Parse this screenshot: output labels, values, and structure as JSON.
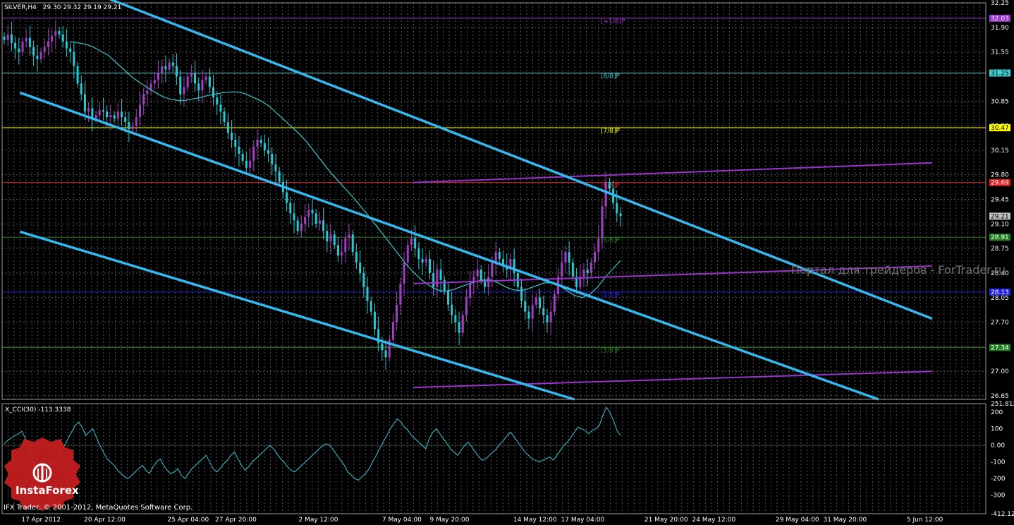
{
  "header": {
    "symbol": "SILVER,H4",
    "ohlc": "29.30 29.32 29.19 29.21"
  },
  "watermark": "Портал для трейдеров - ForTrader.ru",
  "copyright": "IFX Trader, © 2001-2012, MetaQuotes Software Corp.",
  "logo_text": "InstaForex",
  "colors": {
    "background": "#000000",
    "grid": "#5a5a5a",
    "channel": "#33b8f0",
    "ma": "#38c8c8",
    "pitchfork": "#9933cc",
    "bull_start": "#a040c0",
    "bear_start": "#28c8d0",
    "cci": "#38c8d8",
    "logo_red": "#c81e1e"
  },
  "chart_data": {
    "type": "candlestick",
    "symbol": "SILVER",
    "timeframe": "H4",
    "y_ticks": [
      "32.25",
      "31.90",
      "31.55",
      "31.25",
      "30.85",
      "30.50",
      "30.15",
      "29.80",
      "29.45",
      "29.10",
      "28.75",
      "28.40",
      "28.05",
      "27.70",
      "27.35",
      "27.00",
      "26.65"
    ],
    "ylim": [
      26.6,
      32.25
    ],
    "x_ticks": [
      "17 Apr 2012",
      "20 Apr 12:00",
      "25 Apr 04:00",
      "27 Apr 20:00",
      "2 May 12:00",
      "7 May 04:00",
      "9 May 20:00",
      "14 May 12:00",
      "17 May 04:00",
      "21 May 20:00",
      "24 May 12:00",
      "29 May 04:00",
      "31 May 20:00",
      "5 Jun 12:00"
    ],
    "price_tags": [
      {
        "label": "32.03",
        "color": "#9933cc",
        "text_color": "#ffffff"
      },
      {
        "label": "31.25",
        "color": "#40d0d0",
        "text_color": "#000000"
      },
      {
        "label": "30.47",
        "color": "#ffff00",
        "text_color": "#000000"
      },
      {
        "label": "29.69",
        "color": "#e02020",
        "text_color": "#ffffff"
      },
      {
        "label": "29.21",
        "color": "#c0c0c0",
        "text_color": "#000000"
      },
      {
        "label": "28.91",
        "color": "#208020",
        "text_color": "#ffffff"
      },
      {
        "label": "28.13",
        "color": "#2020e0",
        "text_color": "#ffffff"
      },
      {
        "label": "27.34",
        "color": "#208020",
        "text_color": "#ffffff"
      }
    ],
    "murrey_levels": [
      {
        "label": "[+1/8]P",
        "price": 32.03,
        "color": "#9933cc"
      },
      {
        "label": "[8/8]P",
        "price": 31.25,
        "color": "#40d0d0"
      },
      {
        "label": "[7/8]P",
        "price": 30.47,
        "color": "#ffff00"
      },
      {
        "label": "[6/8]P",
        "price": 29.69,
        "color": "#e02020"
      },
      {
        "label": "[5/8]P",
        "price": 28.91,
        "color": "#208020"
      },
      {
        "label": "[4/8]P",
        "price": 28.13,
        "color": "#2020e0"
      },
      {
        "label": "[3/8]P",
        "price": 27.34,
        "color": "#208020"
      }
    ],
    "channel_lines": [
      {
        "from_date": "17 Apr 2012",
        "from": 32.8,
        "to_date": "7 Jun 2012",
        "to": 27.75
      },
      {
        "from_date": "17 Apr 2012",
        "from": 30.97,
        "to_date": "4 Jun 2012",
        "to": 26.6
      },
      {
        "from_date": "17 Apr 2012",
        "from": 28.99,
        "to_date": "18 May 2012",
        "to": 26.6
      }
    ],
    "pitchfork_lines": [
      {
        "from_date": "9 May 2012",
        "from": 29.69,
        "to_date": "7 Jun 2012",
        "to": 29.97
      },
      {
        "from_date": "9 May 2012",
        "from": 28.25,
        "to_date": "7 Jun 2012",
        "to": 28.5
      },
      {
        "from_date": "9 May 2012",
        "from": 26.77,
        "to_date": "7 Jun 2012",
        "to": 27.0
      }
    ],
    "close": [
      31.72,
      31.8,
      31.68,
      31.6,
      31.55,
      31.7,
      31.75,
      31.62,
      31.5,
      31.45,
      31.55,
      31.62,
      31.7,
      31.78,
      31.85,
      31.8,
      31.7,
      31.6,
      31.55,
      31.35,
      31.1,
      30.95,
      30.7,
      30.75,
      30.6,
      30.65,
      30.72,
      30.7,
      30.62,
      30.65,
      30.6,
      30.7,
      30.62,
      30.55,
      30.45,
      30.5,
      30.62,
      30.8,
      30.95,
      31.0,
      31.1,
      31.15,
      31.25,
      31.35,
      31.3,
      31.4,
      31.35,
      31.2,
      30.95,
      31.05,
      31.2,
      31.25,
      31.1,
      31.0,
      31.15,
      31.2,
      31.05,
      30.9,
      30.8,
      30.7,
      30.55,
      30.4,
      30.3,
      30.2,
      30.1,
      30.0,
      29.9,
      30.0,
      30.2,
      30.3,
      30.25,
      30.15,
      30.1,
      29.95,
      29.85,
      29.7,
      29.55,
      29.4,
      29.25,
      29.15,
      29.0,
      29.1,
      29.2,
      29.3,
      29.25,
      29.1,
      29.15,
      29.0,
      28.85,
      28.95,
      28.8,
      28.65,
      28.7,
      28.9,
      28.95,
      28.7,
      28.55,
      28.4,
      28.2,
      28.0,
      27.85,
      27.6,
      27.4,
      27.3,
      27.2,
      27.45,
      27.7,
      27.95,
      28.25,
      28.55,
      28.8,
      28.9,
      28.75,
      28.6,
      28.55,
      28.6,
      28.4,
      28.2,
      28.45,
      28.3,
      28.15,
      27.95,
      27.8,
      27.7,
      27.55,
      27.8,
      28.05,
      28.25,
      28.35,
      28.45,
      28.3,
      28.2,
      28.35,
      28.55,
      28.7,
      28.6,
      28.5,
      28.45,
      28.6,
      28.4,
      28.2,
      28.0,
      27.85,
      27.75,
      27.95,
      28.05,
      27.9,
      27.8,
      27.7,
      27.85,
      28.1,
      28.35,
      28.55,
      28.7,
      28.55,
      28.35,
      28.2,
      28.35,
      28.45,
      28.4,
      28.55,
      28.7,
      28.9,
      29.35,
      29.7,
      29.6,
      29.4,
      29.25,
      29.21
    ],
    "ma_values": [
      31.7,
      31.68,
      31.66,
      31.62,
      31.56,
      31.5,
      31.4,
      31.3,
      31.2,
      31.12,
      31.05,
      30.98,
      30.92,
      30.88,
      30.86,
      30.86,
      30.88,
      30.9,
      30.93,
      30.95,
      30.97,
      30.98,
      30.98,
      30.95,
      30.9,
      30.85,
      30.78,
      30.68,
      30.58,
      30.48,
      30.38,
      30.26,
      30.12,
      29.98,
      29.84,
      29.72,
      29.6,
      29.48,
      29.35,
      29.22,
      29.08,
      28.94,
      28.8,
      28.66,
      28.52,
      28.4,
      28.3,
      28.22,
      28.16,
      28.14,
      28.16,
      28.2,
      28.24,
      28.28,
      28.3,
      28.3,
      28.26,
      28.2,
      28.16,
      28.15,
      28.18,
      28.22,
      28.26,
      28.26,
      28.22,
      28.15,
      28.08,
      28.05,
      28.1,
      28.2,
      28.34,
      28.46,
      28.58
    ],
    "cci": {
      "label": "X_CCI(30) -113.3338",
      "y_ticks": [
        "251.812",
        "200",
        "100",
        "0.00",
        "-100",
        "-200",
        "-300",
        "-412.129"
      ],
      "ylim": [
        -412.129,
        251.812
      ],
      "values": [
        10,
        30,
        45,
        60,
        70,
        85,
        40,
        -20,
        -90,
        -140,
        -190,
        -160,
        -120,
        -90,
        -110,
        -80,
        -40,
        0,
        40,
        80,
        120,
        140,
        110,
        60,
        80,
        100,
        50,
        0,
        -40,
        -80,
        -100,
        -120,
        -150,
        -170,
        -190,
        -200,
        -180,
        -160,
        -140,
        -120,
        -150,
        -170,
        -130,
        -100,
        -80,
        -120,
        -150,
        -170,
        -160,
        -140,
        -180,
        -200,
        -170,
        -140,
        -120,
        -100,
        -80,
        -60,
        -100,
        -140,
        -160,
        -140,
        -110,
        -90,
        -60,
        -40,
        -80,
        -120,
        -150,
        -130,
        -100,
        -80,
        -60,
        -40,
        -20,
        0,
        -20,
        -50,
        -80,
        -100,
        -130,
        -150,
        -160,
        -140,
        -120,
        -100,
        -80,
        -60,
        -40,
        -20,
        0,
        10,
        0,
        -30,
        -60,
        -90,
        -120,
        -160,
        -180,
        -200,
        -210,
        -190,
        -170,
        -140,
        -100,
        -60,
        -20,
        20,
        60,
        100,
        130,
        160,
        140,
        110,
        90,
        60,
        40,
        20,
        0,
        -20,
        40,
        80,
        100,
        70,
        40,
        10,
        -20,
        -40,
        -60,
        -30,
        0,
        20,
        -10,
        -40,
        -70,
        -90,
        -80,
        -60,
        -40,
        -20,
        10,
        30,
        60,
        80,
        50,
        20,
        -10,
        -40,
        -60,
        -80,
        -90,
        -100,
        -90,
        -80,
        -70,
        -90,
        -60,
        -30,
        0,
        20,
        50,
        80,
        110,
        100,
        90,
        70,
        90,
        100,
        120,
        180,
        230,
        200,
        150,
        90,
        60
      ],
      "zero_line": 0
    }
  }
}
